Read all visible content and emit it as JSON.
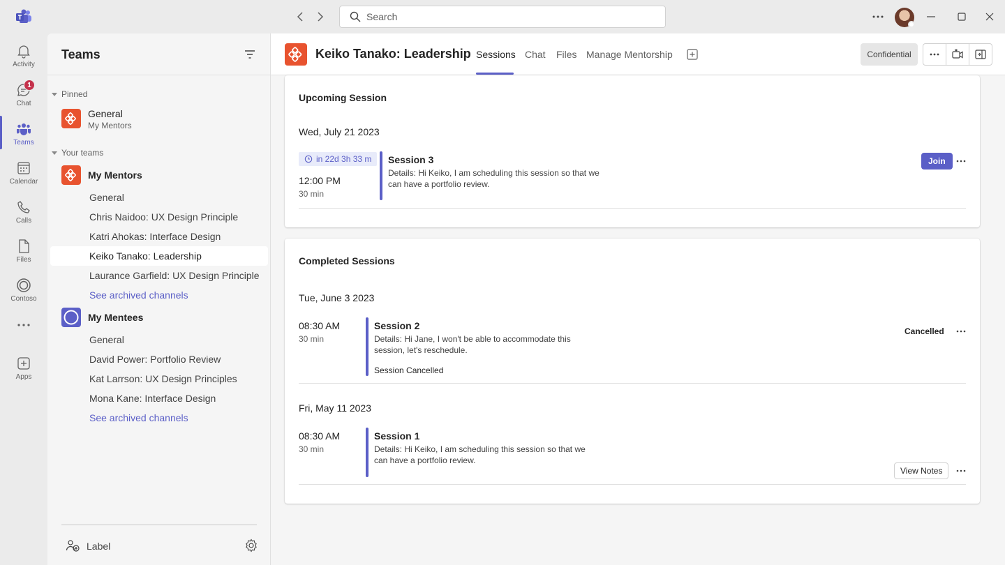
{
  "titlebar": {
    "search_placeholder": "Search",
    "icons": [
      "teams-logo-icon",
      "back-arrow-icon",
      "forward-arrow-icon",
      "search-icon",
      "more-icon",
      "minimize-icon",
      "maximize-icon",
      "close-icon"
    ]
  },
  "rail": {
    "items": [
      {
        "label": "Activity",
        "icon": "bell-icon"
      },
      {
        "label": "Chat",
        "icon": "chat-icon",
        "badge": "1"
      },
      {
        "label": "Teams",
        "icon": "teams-icon",
        "active": true
      },
      {
        "label": "Calendar",
        "icon": "calendar-icon"
      },
      {
        "label": "Calls",
        "icon": "phone-icon"
      },
      {
        "label": "Files",
        "icon": "file-icon"
      },
      {
        "label": "Contoso",
        "icon": "contoso-icon"
      },
      {
        "label": "",
        "icon": "more-icon"
      },
      {
        "label": "Apps",
        "icon": "add-app-icon"
      }
    ]
  },
  "panel": {
    "title": "Teams",
    "pinned_label": "Pinned",
    "pinned": {
      "name": "General",
      "team": "My Mentors"
    },
    "your_teams_label": "Your teams",
    "teams": [
      {
        "name": "My Mentors",
        "color": "#e8532f",
        "channels": [
          "General",
          "Chris Naidoo: UX Design Principle",
          "Katri Ahokas: Interface Design",
          "Keiko Tanako: Leadership",
          "Laurance Garfield: UX Design Principle"
        ],
        "archived_link": "See archived channels"
      },
      {
        "name": "My Mentees",
        "color": "#5b5fc7",
        "channels": [
          "General",
          "David Power: Portfolio Review",
          "Kat Larrson: UX Design Principles",
          "Mona Kane: Interface Design"
        ],
        "archived_link": "See archived channels"
      }
    ],
    "footer_label": "Label"
  },
  "main": {
    "title": "Keiko Tanako: Leadership",
    "tabs": [
      "Sessions",
      "Chat",
      "Files",
      "Manage Mentorship"
    ],
    "active_tab": "Sessions",
    "confidential": "Confidential",
    "upcoming": {
      "title": "Upcoming Session",
      "date": "Wed, July 21 2023",
      "countdown": "in 22d 3h 33 m",
      "time": "12:00 PM",
      "duration": "30 min",
      "session": "Session 3",
      "details": "Details: Hi Keiko, I am scheduling this session so that we can have a portfolio review.",
      "action": "Join"
    },
    "completed": {
      "title": "Completed Sessions",
      "items": [
        {
          "date": "Tue, June 3 2023",
          "time": "08:30 AM",
          "duration": "30 min",
          "session": "Session 2",
          "details": "Details: Hi Jane, I won't be able to accommodate this session, let's reschedule.",
          "note": "Session Cancelled",
          "status": "Cancelled"
        },
        {
          "date": "Fri, May 11 2023",
          "time": "08:30 AM",
          "duration": "30 min",
          "session": "Session 1",
          "details": "Details: Hi Keiko, I am scheduling this session so that we can have a portfolio review.",
          "action": "View Notes"
        }
      ]
    }
  },
  "colors": {
    "brand": "#5b5fc7",
    "team_orange": "#e8532f",
    "badge_red": "#c4314b"
  }
}
